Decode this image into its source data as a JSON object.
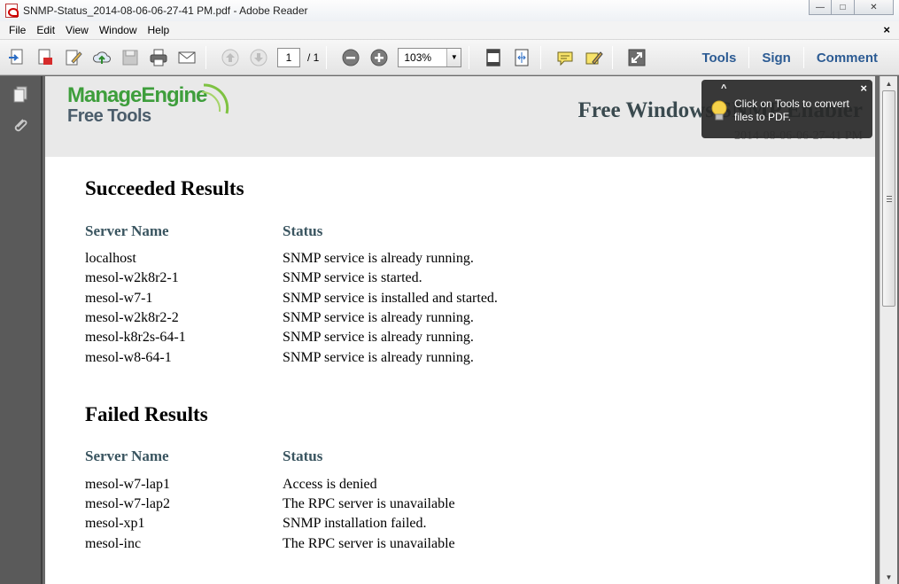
{
  "window": {
    "title": "SNMP-Status_2014-08-06-06-27-41 PM.pdf - Adobe Reader",
    "minimize_glyph": "—",
    "maximize_glyph": "□",
    "close_glyph": "✕"
  },
  "menu": {
    "items": [
      "File",
      "Edit",
      "View",
      "Window",
      "Help"
    ],
    "doc_close": "×"
  },
  "toolbar": {
    "page_current": "1",
    "page_total": "/ 1",
    "zoom": "103%",
    "links": [
      "Tools",
      "Sign",
      "Comment"
    ]
  },
  "tooltip": {
    "arrow": "^",
    "close": "×",
    "text": "Click on Tools to convert files to PDF."
  },
  "document": {
    "logo_main": "ManageEngine",
    "logo_sub": "Free Tools",
    "report_title": "Free Windows SNMP Enabler",
    "report_date": "2014-08-06-06-27-41 PM",
    "succeeded": {
      "title": "Succeeded Results",
      "col_server": "Server Name",
      "col_status": "Status",
      "rows": [
        {
          "server": "localhost",
          "status": "SNMP service is already running."
        },
        {
          "server": "mesol-w2k8r2-1",
          "status": "SNMP service is started."
        },
        {
          "server": "mesol-w7-1",
          "status": "SNMP service is installed and started."
        },
        {
          "server": "mesol-w2k8r2-2",
          "status": "SNMP service is already running."
        },
        {
          "server": "mesol-k8r2s-64-1",
          "status": "SNMP service is already running."
        },
        {
          "server": "mesol-w8-64-1",
          "status": "SNMP service is already running."
        }
      ]
    },
    "failed": {
      "title": "Failed Results",
      "col_server": "Server Name",
      "col_status": "Status",
      "rows": [
        {
          "server": "mesol-w7-lap1",
          "status": "Access is denied"
        },
        {
          "server": "mesol-w7-lap2",
          "status": "The RPC server is unavailable"
        },
        {
          "server": "mesol-xp1",
          "status": "SNMP installation failed."
        },
        {
          "server": "mesol-inc",
          "status": "The RPC server is unavailable"
        }
      ]
    }
  }
}
